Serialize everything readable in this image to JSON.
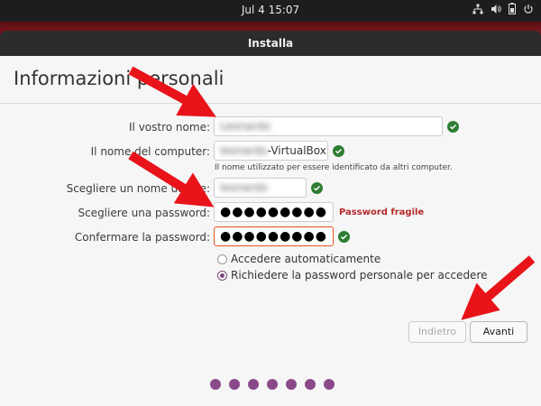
{
  "topbar": {
    "clock": "Jul 4  15:07",
    "icons": [
      "network-icon",
      "volume-icon",
      "battery-icon",
      "power-menu-icon"
    ]
  },
  "window": {
    "title": "Installa"
  },
  "page": {
    "heading": "Informazioni personali"
  },
  "form": {
    "name_label": "Il vostro nome:",
    "name_value": "Leonardo",
    "computer_label": "Il nome del computer:",
    "computer_prefix": "leonardo",
    "computer_suffix": "-VirtualBox",
    "computer_hint": "Il nome utilizzato per essere identificato da altri computer.",
    "username_label": "Scegliere un nome utente:",
    "username_value": "leonardo",
    "password_label": "Scegliere una password:",
    "password_value": "●●●●●●●●●",
    "password_strength": "Password fragile",
    "confirm_label": "Confermare la password:",
    "confirm_value": "●●●●●●●●●"
  },
  "login_options": {
    "auto_label": "Accedere automaticamente",
    "require_label": "Richiedere la password personale per accedere",
    "selected": "require"
  },
  "buttons": {
    "back_label": "Indietro",
    "next_label": "Avanti"
  },
  "progress": {
    "total_steps": 7
  },
  "colors": {
    "accent": "#e95420",
    "success": "#2e7d32",
    "warning_text": "#b5282b",
    "progress_dot": "#8a4a8a",
    "annotation_arrow": "#e8141a"
  }
}
